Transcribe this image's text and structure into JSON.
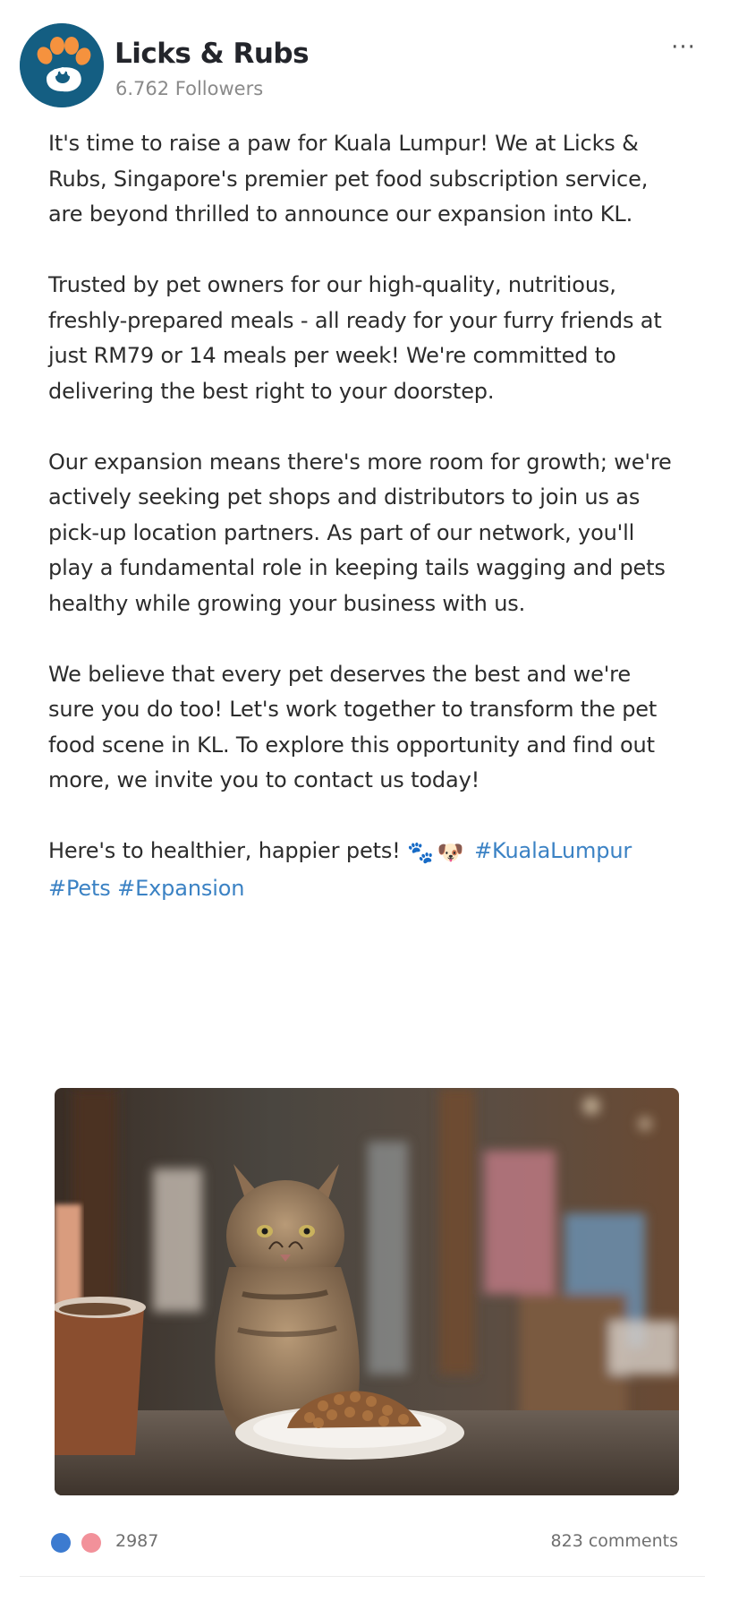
{
  "author": {
    "name": "Licks & Rubs",
    "followers": "6.762 Followers",
    "more_label": "···"
  },
  "post": {
    "paragraphs": [
      "It's time to raise a paw for Kuala Lumpur! We at Licks & Rubs, Singapore's premier pet food subscription service, are beyond thrilled to announce our expansion into KL.",
      "Trusted by pet owners for our high-quality, nutritious, freshly-prepared meals - all ready for your furry friends at just RM79 or 14 meals per week! We're committed to delivering the best right to your doorstep.",
      "Our expansion means there's more room for growth; we're actively seeking pet shops and distributors to join us as pick-up location partners. As part of our network, you'll play a fundamental role in keeping tails wagging and pets healthy while growing your business with us.",
      "We believe that every pet deserves the best and we're sure you do too! Let's work together to transform the pet food scene in KL. To explore this opportunity and find out more, we invite you to contact us today!"
    ],
    "closing_text": "Here's to healthier, happier pets!",
    "emojis": [
      "🐾",
      "🐶"
    ],
    "hashtags": [
      "#KualaLumpur",
      "#Pets",
      "#Expansion"
    ]
  },
  "footer": {
    "reactions_count": "2987",
    "comments_count": "823 comments"
  },
  "colors": {
    "avatar_bg": "#145e82",
    "avatar_paw": "#f5923e",
    "hashtag": "#3b82c4",
    "reaction_blue": "#3c7bd0",
    "reaction_pink": "#f2919a"
  },
  "icons": {
    "avatar": "paw-logo-icon",
    "more": "more-options-icon",
    "reaction_1": "like-reaction-icon",
    "reaction_2": "love-reaction-icon"
  }
}
